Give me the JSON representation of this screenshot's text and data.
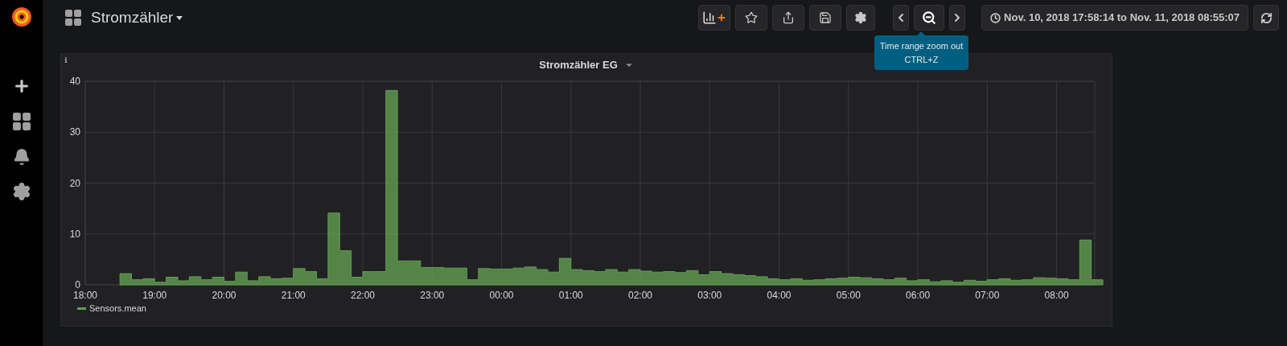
{
  "dashboard": {
    "title": "Stromzähler"
  },
  "toolbar": {
    "time_range": "Nov. 10, 2018 17:58:14 to Nov. 11, 2018 08:55:07"
  },
  "tooltip": {
    "lines": [
      "Time range zoom out",
      "CTRL+Z"
    ]
  },
  "panel": {
    "title": "Stromzähler EG",
    "info_marker": "i",
    "chart_data": {
      "type": "area",
      "categories": [
        "18:00",
        null,
        null,
        null,
        null,
        null,
        "19:00",
        null,
        null,
        null,
        null,
        null,
        "20:00",
        null,
        null,
        null,
        null,
        null,
        "21:00",
        null,
        null,
        null,
        null,
        null,
        "22:00",
        null,
        null,
        null,
        null,
        null,
        "23:00",
        null,
        null,
        null,
        null,
        null,
        "00:00",
        null,
        null,
        null,
        null,
        null,
        "01:00",
        null,
        null,
        null,
        null,
        null,
        "02:00",
        null,
        null,
        null,
        null,
        null,
        "03:00",
        null,
        null,
        null,
        null,
        null,
        "04:00",
        null,
        null,
        null,
        null,
        null,
        "05:00",
        null,
        null,
        null,
        null,
        null,
        "06:00",
        null,
        null,
        null,
        null,
        null,
        "07:00",
        null,
        null,
        null,
        null,
        null,
        "08:00",
        null,
        null,
        null
      ],
      "series": [
        {
          "name": "Sensors.mean",
          "color": "#629e51",
          "values": [
            null,
            null,
            null,
            2.2,
            1.0,
            1.2,
            0.5,
            1.5,
            0.8,
            1.6,
            1.0,
            1.5,
            0.7,
            2.5,
            0.8,
            1.6,
            1.2,
            1.3,
            3.2,
            2.6,
            1.2,
            14.1,
            6.7,
            1.5,
            2.6,
            2.6,
            38.2,
            4.7,
            4.7,
            3.4,
            3.4,
            3.3,
            3.3,
            1.0,
            3.2,
            3.1,
            3.1,
            3.3,
            3.5,
            3.0,
            2.5,
            5.2,
            3.0,
            2.8,
            2.6,
            3.0,
            2.5,
            3.0,
            2.7,
            2.5,
            2.6,
            2.4,
            2.8,
            2.0,
            2.6,
            2.2,
            2.0,
            1.8,
            1.6,
            1.2,
            1.0,
            1.2,
            0.9,
            1.0,
            1.2,
            1.3,
            1.5,
            1.4,
            1.2,
            1.0,
            1.3,
            0.8,
            1.0,
            0.6,
            0.8,
            0.5,
            0.9,
            0.7,
            1.0,
            1.2,
            0.9,
            1.0,
            1.4,
            1.3,
            1.2,
            1.0,
            8.8,
            1.0
          ]
        }
      ],
      "ylim": [
        0,
        40
      ],
      "grid": true,
      "yticks": [
        0,
        10,
        20,
        30,
        40
      ]
    }
  }
}
